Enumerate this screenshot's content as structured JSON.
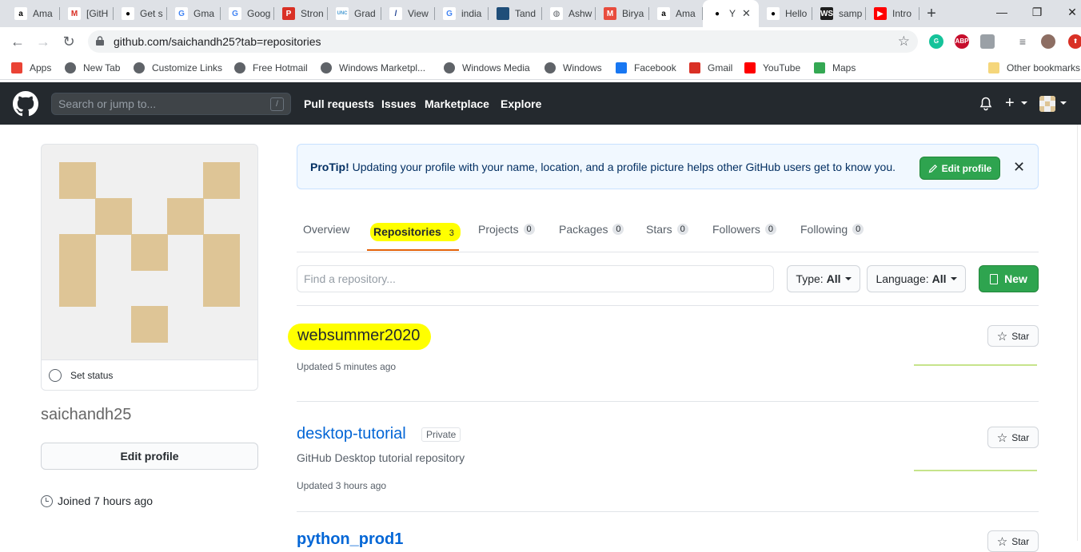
{
  "browser": {
    "tabs": [
      {
        "title": "Ama",
        "color": "#ffffff",
        "glyph": "a",
        "glyph_color": "#000"
      },
      {
        "title": "[GitH",
        "color": "#ffffff",
        "glyph": "M",
        "glyph_color": "#d93025"
      },
      {
        "title": "Get s",
        "color": "#ffffff",
        "glyph": "gh",
        "glyph_color": "#000"
      },
      {
        "title": "Gma",
        "color": "#ffffff",
        "glyph": "G",
        "glyph_color": "#4285f4"
      },
      {
        "title": "Goog",
        "color": "#ffffff",
        "glyph": "G",
        "glyph_color": "#4285f4"
      },
      {
        "title": "Stron",
        "color": "#d93025",
        "glyph": "P",
        "glyph_color": "#fff"
      },
      {
        "title": "Grad",
        "color": "#ffffff",
        "glyph": "UNC",
        "glyph_color": "#4b9cd3"
      },
      {
        "title": "View",
        "color": "#ffffff",
        "glyph": "/",
        "glyph_color": "#1a3d8f"
      },
      {
        "title": "india",
        "color": "#ffffff",
        "glyph": "G",
        "glyph_color": "#4285f4"
      },
      {
        "title": "Tand",
        "color": "#1f4e79",
        "glyph": "",
        "glyph_color": "#fff"
      },
      {
        "title": "Ashw",
        "color": "#ffffff",
        "glyph": "◍",
        "glyph_color": "#5f6368"
      },
      {
        "title": "Birya",
        "color": "#e84c3d",
        "glyph": "M",
        "glyph_color": "#fff"
      },
      {
        "title": "Ama",
        "color": "#ffffff",
        "glyph": "a",
        "glyph_color": "#000"
      },
      {
        "title": "Y",
        "color": "#ffffff",
        "glyph": "gh",
        "glyph_color": "#000"
      },
      {
        "title": "Hello",
        "color": "#ffffff",
        "glyph": "gh",
        "glyph_color": "#000"
      },
      {
        "title": "samp",
        "color": "#1e1e1e",
        "glyph": "WS",
        "glyph_color": "#fff"
      },
      {
        "title": "Intro",
        "color": "#ff0000",
        "glyph": "▶",
        "glyph_color": "#fff"
      }
    ],
    "active_tab_index": 13,
    "new_tab": "+",
    "window_controls": {
      "minimize": "—",
      "maximize": "❐",
      "close": "✕"
    },
    "url": "github.com/saichandh25?tab=repositories",
    "extensions": [
      {
        "label": "G",
        "color": "#15c39a"
      },
      {
        "label": "ABP",
        "color": "#c70d2c"
      },
      {
        "label": "",
        "color": "#9aa0a6"
      },
      {
        "label": "≡",
        "color": "#5f6368"
      },
      {
        "label": "",
        "color": "#8d6e63"
      },
      {
        "label": "⬆",
        "color": "#d93025"
      }
    ],
    "bookmarks": [
      {
        "label": "Apps",
        "icon": "apps-grid"
      },
      {
        "label": "New Tab",
        "icon": "globe"
      },
      {
        "label": "Customize Links",
        "icon": "globe"
      },
      {
        "label": "Free Hotmail",
        "icon": "globe"
      },
      {
        "label": "Windows Marketpl...",
        "icon": "globe"
      },
      {
        "label": "Windows Media",
        "icon": "globe"
      },
      {
        "label": "Windows",
        "icon": "globe"
      },
      {
        "label": "Facebook",
        "icon": "facebook"
      },
      {
        "label": "Gmail",
        "icon": "gmail"
      },
      {
        "label": "YouTube",
        "icon": "youtube"
      },
      {
        "label": "Maps",
        "icon": "maps"
      }
    ],
    "other_bookmarks": "Other bookmarks"
  },
  "github": {
    "search_placeholder": "Search or jump to...",
    "search_key": "/",
    "nav": [
      "Pull requests",
      "Issues",
      "Marketplace",
      "Explore"
    ],
    "colors": {
      "header": "#24292e",
      "green": "#2ea44f",
      "link": "#0366d6",
      "highlight": "#ffff00",
      "tab_underline": "#e36209"
    }
  },
  "profile": {
    "set_status": "Set status",
    "username": "saichandh25",
    "edit_profile": "Edit profile",
    "joined": "Joined 7 hours ago"
  },
  "protip": {
    "label": "ProTip!",
    "text": " Updating your profile with your name, location, and a profile picture helps other GitHub users get to know you.",
    "button": "Edit profile",
    "close": "✕"
  },
  "tabs": [
    {
      "label": "Overview",
      "count": ""
    },
    {
      "label": "Repositories",
      "count": "3"
    },
    {
      "label": "Projects",
      "count": "0"
    },
    {
      "label": "Packages",
      "count": "0"
    },
    {
      "label": "Stars",
      "count": "0"
    },
    {
      "label": "Followers",
      "count": "0"
    },
    {
      "label": "Following",
      "count": "0"
    }
  ],
  "filters": {
    "find_placeholder": "Find a repository...",
    "type_label": "Type:",
    "type_value": "All",
    "language_label": "Language:",
    "language_value": "All",
    "new_button": "New"
  },
  "repos": [
    {
      "name": "websummer2020",
      "description": "",
      "private": "",
      "updated": "Updated 5 minutes ago",
      "star": "Star"
    },
    {
      "name": "desktop-tutorial",
      "description": "GitHub Desktop tutorial repository",
      "private": "Private",
      "updated": "Updated 3 hours ago",
      "star": "Star"
    }
  ],
  "partial_repo_name": "python_prod1"
}
